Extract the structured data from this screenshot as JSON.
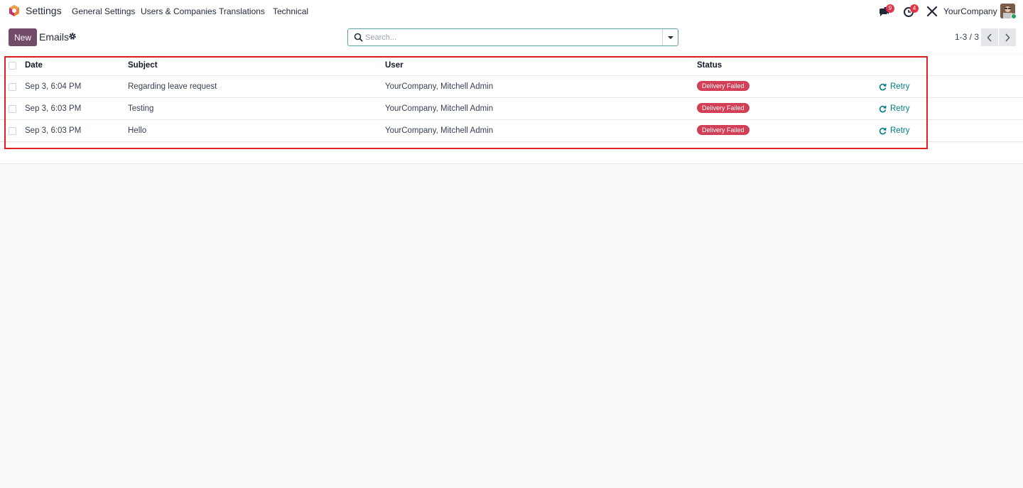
{
  "navbar": {
    "app_name": "Settings",
    "menu": [
      "General Settings",
      "Users & Companies",
      "Translations",
      "Technical"
    ],
    "messages_count": "9",
    "activities_count": "4",
    "company": "YourCompany"
  },
  "control_panel": {
    "new_label": "New",
    "title": "Emails",
    "search_placeholder": "Search...",
    "pager": "1-3 / 3"
  },
  "table": {
    "columns": [
      "Date",
      "Subject",
      "User",
      "Status"
    ],
    "rows": [
      {
        "date": "Sep 3, 6:04 PM",
        "subject": "Regarding leave request",
        "user": "YourCompany, Mitchell Admin",
        "status": "Delivery Failed",
        "action": "Retry"
      },
      {
        "date": "Sep 3, 6:03 PM",
        "subject": "Testing",
        "user": "YourCompany, Mitchell Admin",
        "status": "Delivery Failed",
        "action": "Retry"
      },
      {
        "date": "Sep 3, 6:03 PM",
        "subject": "Hello",
        "user": "YourCompany, Mitchell Admin",
        "status": "Delivery Failed",
        "action": "Retry"
      }
    ]
  },
  "colors": {
    "brand": "#714b67",
    "status_failed": "#d23f56",
    "retry_link": "#017e84",
    "highlight": "#e02020"
  },
  "icons": [
    "app-logo-icon",
    "chat-icon",
    "clock-icon",
    "tools-icon",
    "gear-icon",
    "search-icon",
    "chevron-left-icon",
    "chevron-right-icon",
    "refresh-icon"
  ]
}
